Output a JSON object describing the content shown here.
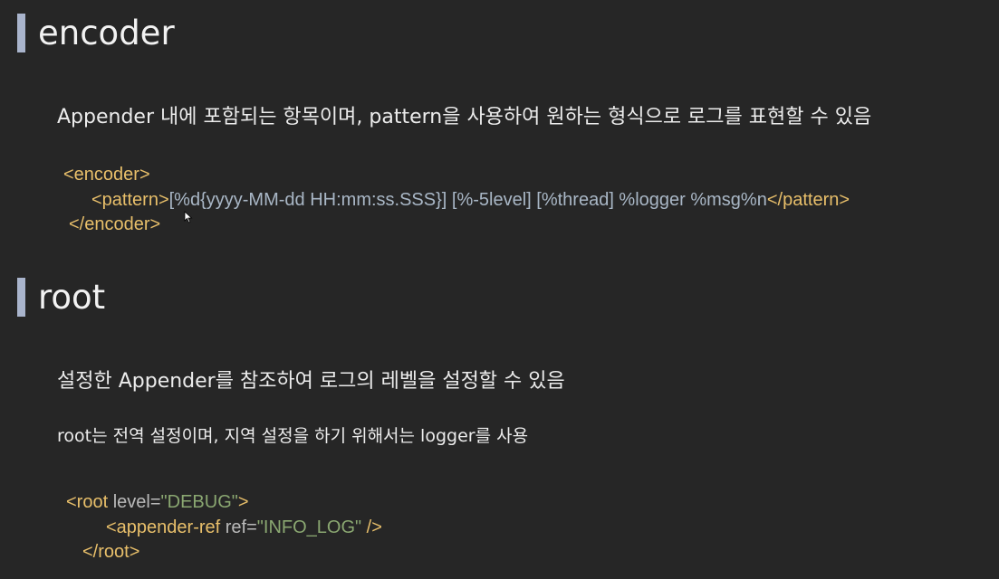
{
  "encoder_section": {
    "title": "encoder",
    "description": "Appender 내에 포함되는 항목이며, pattern을 사용하여 원하는 형식으로 로그를 표현할 수 있음",
    "code": {
      "open_tag": "<encoder>",
      "pattern_open": "<pattern>",
      "pattern_value": "[%d{yyyy-MM-dd HH:mm:ss.SSS}] [%-5level] [%thread] %logger %msg%n",
      "pattern_close": "</pattern>",
      "close_tag": "</encoder>"
    }
  },
  "root_section": {
    "title": "root",
    "description1": "설정한 Appender를 참조하여 로그의 레벨을 설정할 수 있음",
    "description2": "root는 전역 설정이며, 지역 설정을 하기 위해서는 logger를 사용",
    "code": {
      "root_open_start": "<root",
      "root_attr": " level=",
      "root_attr_value": "\"DEBUG\"",
      "root_open_end": ">",
      "ref_open": "<appender-ref",
      "ref_attr": " ref=",
      "ref_attr_value": "\"INFO_LOG\"",
      "ref_close": " />",
      "root_close": "</root>"
    }
  },
  "colors": {
    "background": "#262626",
    "accent_bar": "#a9b4cc",
    "xml_tag": "#e8bf6a",
    "xml_attribute": "#bababa",
    "xml_value": "#8aa771",
    "xml_text": "#a9b7c6"
  },
  "icons": {
    "cursor": "mouse-pointer-icon"
  }
}
